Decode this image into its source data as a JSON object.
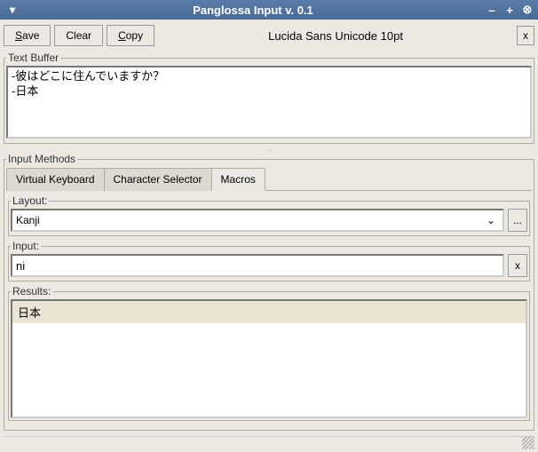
{
  "titlebar": {
    "title": "Panglossa Input v. 0.1"
  },
  "toolbar": {
    "save": "Save",
    "clear": "Clear",
    "copy": "Copy",
    "font": "Lucida Sans Unicode 10pt",
    "close": "x"
  },
  "textbuffer": {
    "legend": "Text Buffer",
    "content": "-彼はどこに住んでいますか？\n-日本"
  },
  "input_methods": {
    "legend": "Input Methods",
    "tabs": [
      {
        "label": "Virtual Keyboard"
      },
      {
        "label": "Character Selector"
      },
      {
        "label": "Macros"
      }
    ],
    "active_tab": 2,
    "layout": {
      "label": "Layout:",
      "value": "Kanji",
      "more": "..."
    },
    "input": {
      "label": "Input:",
      "value": "ni",
      "clear": "x"
    },
    "results": {
      "label": "Results:",
      "items": [
        "日本"
      ]
    }
  }
}
